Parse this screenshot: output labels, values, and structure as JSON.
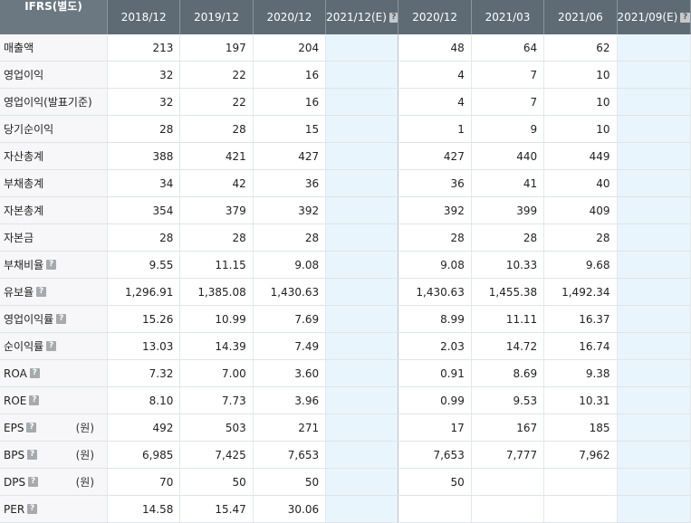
{
  "header": {
    "corner_label": "IFRS(별도)",
    "help_glyph": "?",
    "periods": [
      {
        "label": "2018/12",
        "estimate": false,
        "help": false
      },
      {
        "label": "2019/12",
        "estimate": false,
        "help": false
      },
      {
        "label": "2020/12",
        "estimate": false,
        "help": false
      },
      {
        "label": "2021/12(E)",
        "estimate": true,
        "help": true
      },
      {
        "label": "2020/12",
        "estimate": false,
        "help": false
      },
      {
        "label": "2021/03",
        "estimate": false,
        "help": false
      },
      {
        "label": "2021/06",
        "estimate": false,
        "help": false
      },
      {
        "label": "2021/09(E)",
        "estimate": true,
        "help": true
      }
    ]
  },
  "rows": [
    {
      "label": "매출액",
      "help": false,
      "unit": "",
      "values": [
        "213",
        "197",
        "204",
        "",
        "48",
        "64",
        "62",
        ""
      ]
    },
    {
      "label": "영업이익",
      "help": false,
      "unit": "",
      "values": [
        "32",
        "22",
        "16",
        "",
        "4",
        "7",
        "10",
        ""
      ]
    },
    {
      "label": "영업이익(발표기준)",
      "help": false,
      "unit": "",
      "values": [
        "32",
        "22",
        "16",
        "",
        "4",
        "7",
        "10",
        ""
      ]
    },
    {
      "label": "당기순이익",
      "help": false,
      "unit": "",
      "values": [
        "28",
        "28",
        "15",
        "",
        "1",
        "9",
        "10",
        ""
      ]
    },
    {
      "label": "자산총계",
      "help": false,
      "unit": "",
      "values": [
        "388",
        "421",
        "427",
        "",
        "427",
        "440",
        "449",
        ""
      ]
    },
    {
      "label": "부채총계",
      "help": false,
      "unit": "",
      "values": [
        "34",
        "42",
        "36",
        "",
        "36",
        "41",
        "40",
        ""
      ]
    },
    {
      "label": "자본총계",
      "help": false,
      "unit": "",
      "values": [
        "354",
        "379",
        "392",
        "",
        "392",
        "399",
        "409",
        ""
      ]
    },
    {
      "label": "자본금",
      "help": false,
      "unit": "",
      "values": [
        "28",
        "28",
        "28",
        "",
        "28",
        "28",
        "28",
        ""
      ]
    },
    {
      "label": "부채비율",
      "help": true,
      "unit": "",
      "values": [
        "9.55",
        "11.15",
        "9.08",
        "",
        "9.08",
        "10.33",
        "9.68",
        ""
      ]
    },
    {
      "label": "유보율",
      "help": true,
      "unit": "",
      "values": [
        "1,296.91",
        "1,385.08",
        "1,430.63",
        "",
        "1,430.63",
        "1,455.38",
        "1,492.34",
        ""
      ]
    },
    {
      "label": "영업이익률",
      "help": true,
      "unit": "",
      "values": [
        "15.26",
        "10.99",
        "7.69",
        "",
        "8.99",
        "11.11",
        "16.37",
        ""
      ]
    },
    {
      "label": "순이익률",
      "help": true,
      "unit": "",
      "values": [
        "13.03",
        "14.39",
        "7.49",
        "",
        "2.03",
        "14.72",
        "16.74",
        ""
      ]
    },
    {
      "label": "ROA",
      "help": true,
      "unit": "",
      "values": [
        "7.32",
        "7.00",
        "3.60",
        "",
        "0.91",
        "8.69",
        "9.38",
        ""
      ]
    },
    {
      "label": "ROE",
      "help": true,
      "unit": "",
      "values": [
        "8.10",
        "7.73",
        "3.96",
        "",
        "0.99",
        "9.53",
        "10.31",
        ""
      ]
    },
    {
      "label": "EPS",
      "help": true,
      "unit": "(원)",
      "values": [
        "492",
        "503",
        "271",
        "",
        "17",
        "167",
        "185",
        ""
      ]
    },
    {
      "label": "BPS",
      "help": true,
      "unit": "(원)",
      "values": [
        "6,985",
        "7,425",
        "7,653",
        "",
        "7,653",
        "7,777",
        "7,962",
        ""
      ]
    },
    {
      "label": "DPS",
      "help": true,
      "unit": "(원)",
      "values": [
        "70",
        "50",
        "50",
        "",
        "50",
        "",
        "",
        ""
      ]
    },
    {
      "label": "PER",
      "help": true,
      "unit": "",
      "values": [
        "14.58",
        "15.47",
        "30.06",
        "",
        "",
        "",
        "",
        ""
      ]
    }
  ]
}
